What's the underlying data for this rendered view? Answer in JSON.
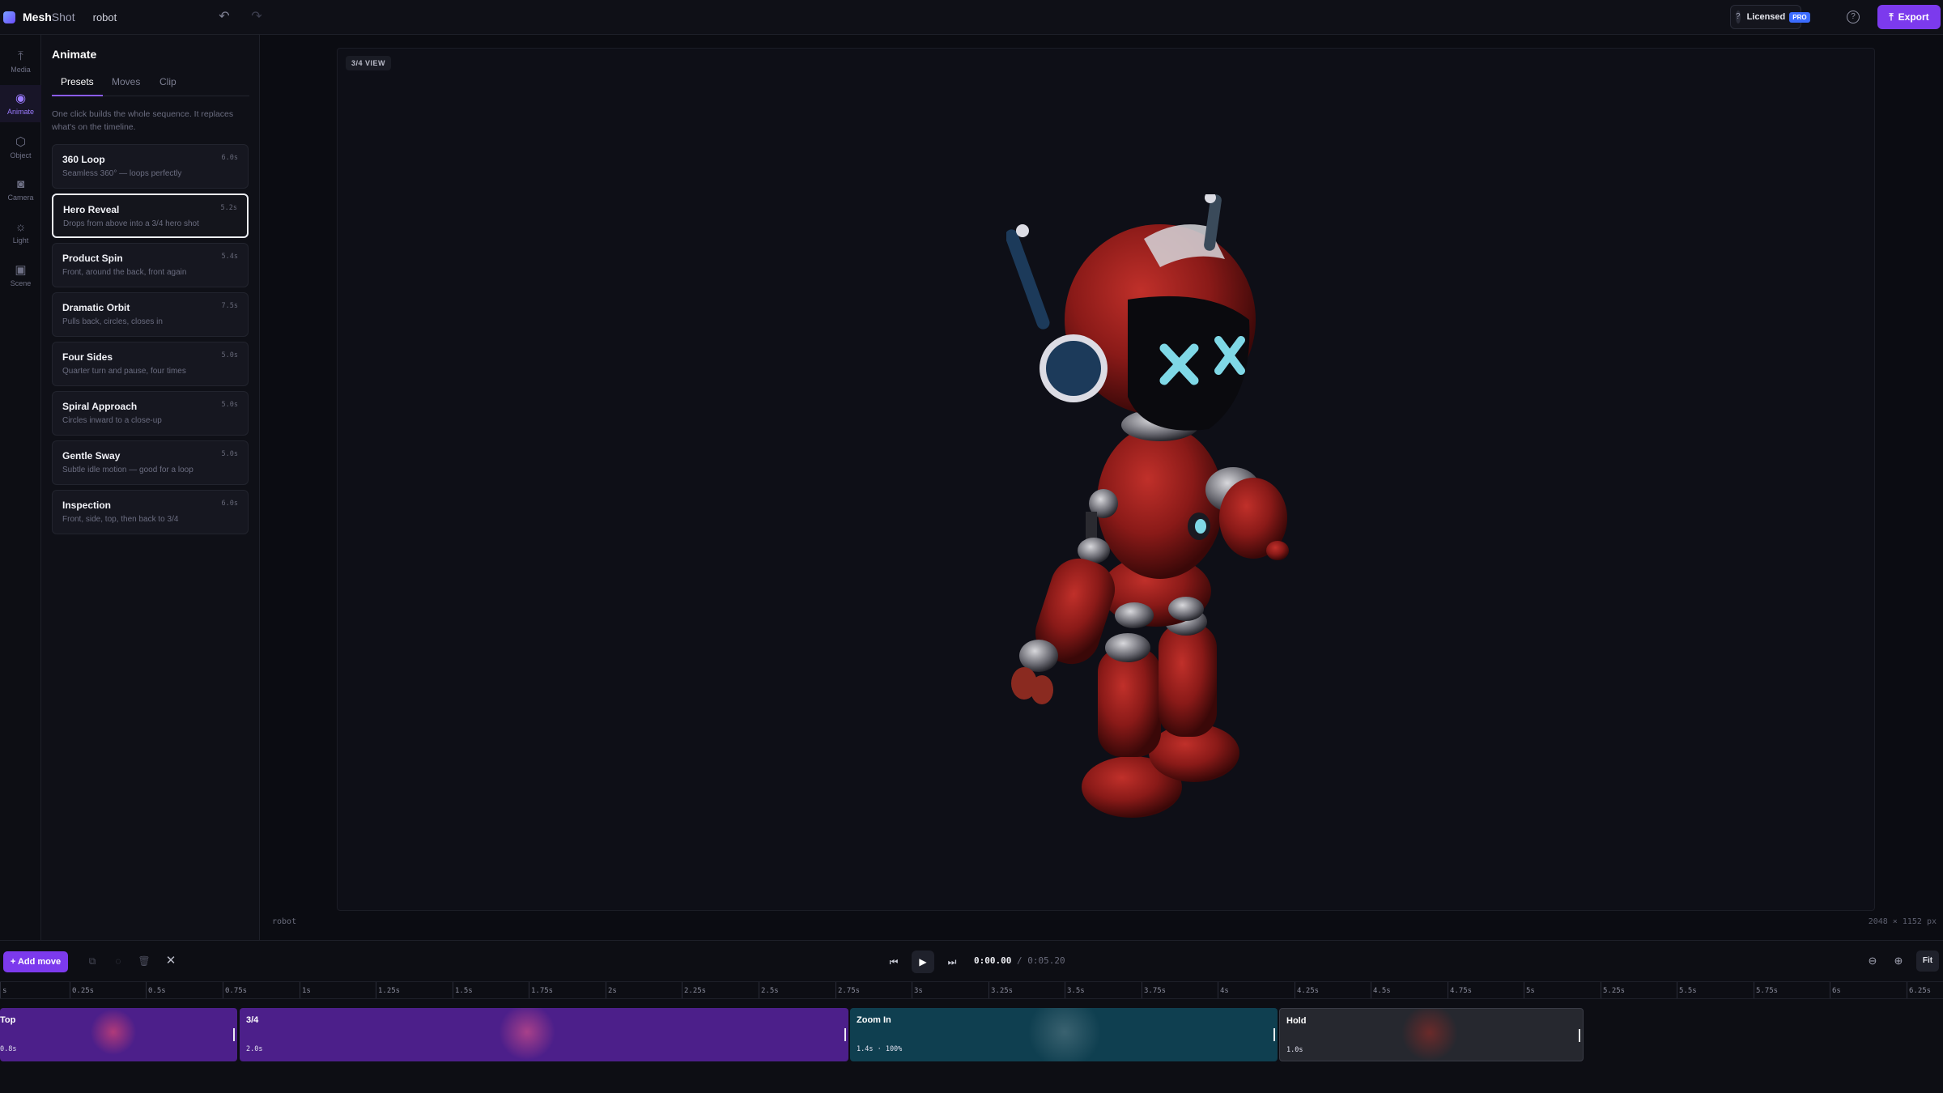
{
  "app": {
    "brand_main": "Mesh",
    "brand_sub": "Shot",
    "project_name": "robot"
  },
  "license": {
    "help_glyph": "?",
    "label": "Licensed",
    "badge": "PRO"
  },
  "toolbar": {
    "export_label": "Export",
    "help_glyph": "?"
  },
  "rail": [
    {
      "label": "Media",
      "icon": "upload-icon"
    },
    {
      "label": "Animate",
      "icon": "animate-icon",
      "active": true
    },
    {
      "label": "Object",
      "icon": "cube-icon"
    },
    {
      "label": "Camera",
      "icon": "camera-icon"
    },
    {
      "label": "Light",
      "icon": "sun-icon"
    },
    {
      "label": "Scene",
      "icon": "image-icon"
    }
  ],
  "panel": {
    "title": "Animate",
    "tabs": [
      "Presets",
      "Moves",
      "Clip"
    ],
    "active_tab": "Presets",
    "description": "One click builds the whole sequence. It replaces what's on the timeline.",
    "presets": [
      {
        "name": "360 Loop",
        "desc": "Seamless 360° — loops perfectly",
        "time": "6.0s"
      },
      {
        "name": "Hero Reveal",
        "desc": "Drops from above into a 3/4 hero shot",
        "time": "5.2s",
        "selected": true
      },
      {
        "name": "Product Spin",
        "desc": "Front, around the back, front again",
        "time": "5.4s"
      },
      {
        "name": "Dramatic Orbit",
        "desc": "Pulls back, circles, closes in",
        "time": "7.5s"
      },
      {
        "name": "Four Sides",
        "desc": "Quarter turn and pause, four times",
        "time": "5.0s"
      },
      {
        "name": "Spiral Approach",
        "desc": "Circles inward to a close-up",
        "time": "5.0s"
      },
      {
        "name": "Gentle Sway",
        "desc": "Subtle idle motion — good for a loop",
        "time": "5.0s"
      },
      {
        "name": "Inspection",
        "desc": "Front, side, top, then back to 3/4",
        "time": "6.0s"
      }
    ]
  },
  "viewport": {
    "view_label": "3/4 VIEW",
    "model_name": "robot",
    "resolution": "2048 × 1152 px"
  },
  "timeline": {
    "add_move_label": "+ Add move",
    "current_time": "0:00.00",
    "separator": "/",
    "duration": "0:05.20",
    "fit_label": "Fit",
    "ruler": [
      "s",
      "0.25s",
      "0.5s",
      "0.75s",
      "1s",
      "1.25s",
      "1.5s",
      "1.75s",
      "2s",
      "2.25s",
      "2.5s",
      "2.75s",
      "3s",
      "3.25s",
      "3.5s",
      "3.75s",
      "4s",
      "4.25s",
      "4.5s",
      "4.75s",
      "5s",
      "5.25s",
      "5.5s",
      "5.75s",
      "6s",
      "6.25s"
    ],
    "clips": [
      {
        "name": "Top",
        "duration": "0.8s",
        "color": "#4c1f8a"
      },
      {
        "name": "3/4",
        "duration": "2.0s",
        "color": "#4c1f8a"
      },
      {
        "name": "Zoom In",
        "duration": "1.4s · 100%",
        "color": "#0f3f50"
      },
      {
        "name": "Hold",
        "duration": "1.0s",
        "color": "#26282f"
      }
    ]
  },
  "colors": {
    "accent": "#7c3aed",
    "pro_badge": "#3b6cff",
    "robot_red": "#9b1c1c",
    "robot_eye": "#7fd8e6"
  }
}
